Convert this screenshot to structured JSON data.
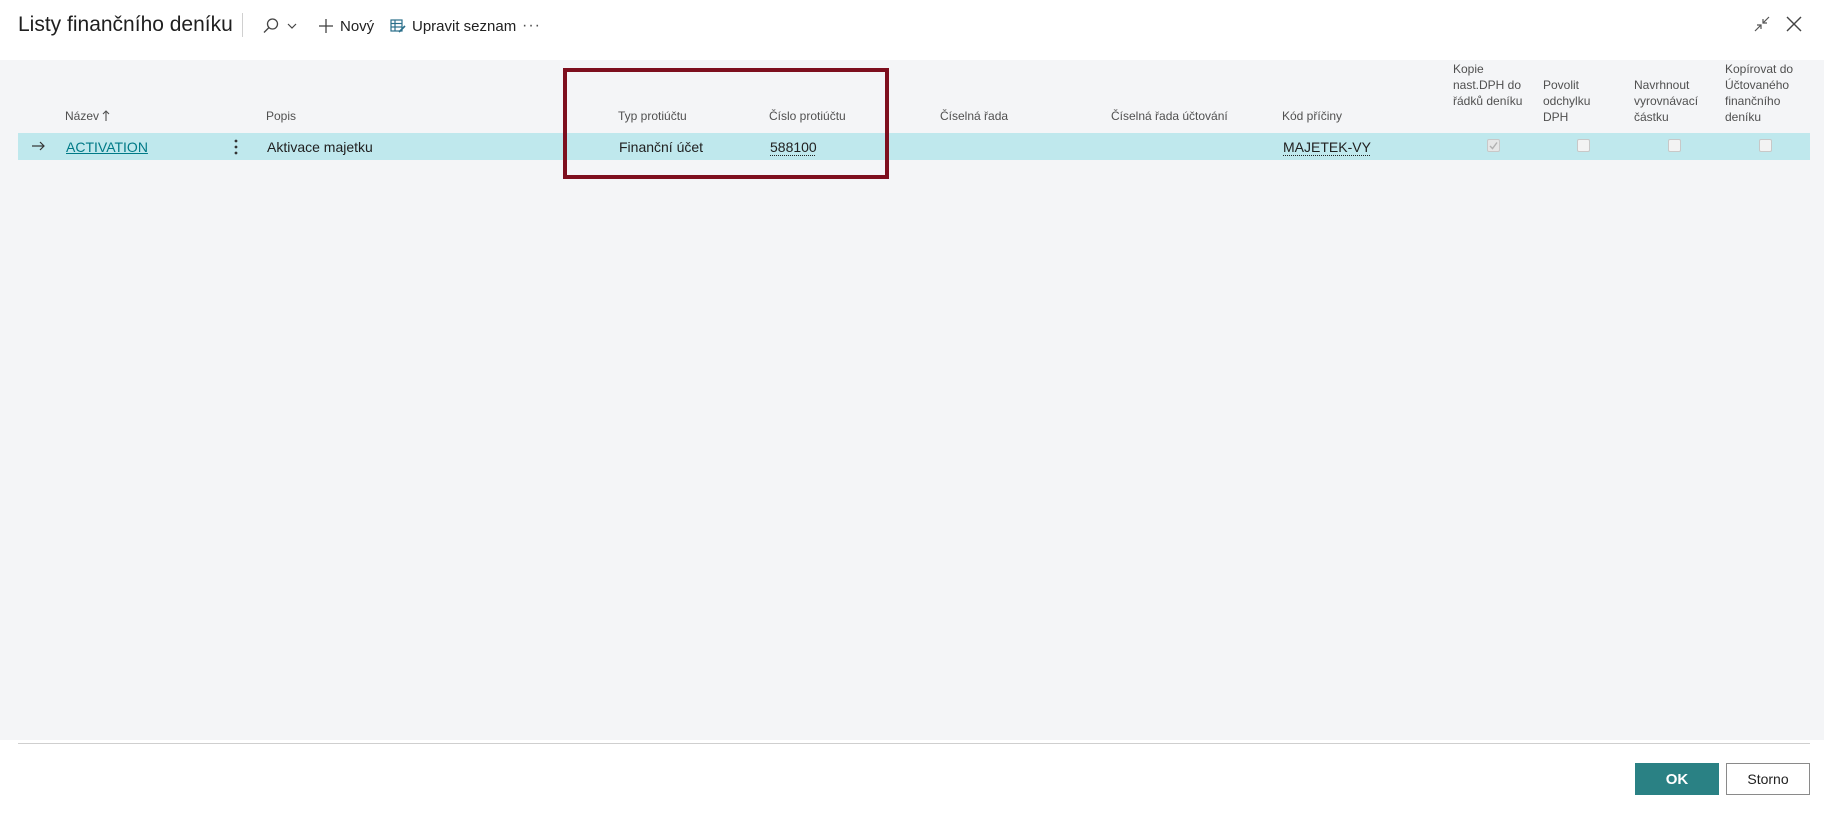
{
  "header": {
    "title": "Listy finančního deníku",
    "new_label": "Nový",
    "edit_list_label": "Upravit seznam",
    "more_label": "···"
  },
  "columns": {
    "name": "Název",
    "description": "Popis",
    "bal_account_type": "Typ protiúčtu",
    "bal_account_no": "Číslo protiúčtu",
    "no_series": "Číselná řada",
    "posting_no_series": "Číselná řada účtování",
    "reason_code": "Kód příčiny",
    "copy_vat_setup": "Kopie nast.DPH do řádků deníku",
    "allow_vat_difference": "Povolit odchylku DPH",
    "suggest_balancing": "Navrhnout vyrovnávací částku",
    "copy_to_posted": "Kopírovat do Účtovaného finančního deníku"
  },
  "rows": [
    {
      "name": "ACTIVATION",
      "description": "Aktivace majetku",
      "bal_account_type": "Finanční účet",
      "bal_account_no": "588100",
      "no_series": "",
      "posting_no_series": "",
      "reason_code": "MAJETEK-VY",
      "copy_vat_setup": true,
      "allow_vat_difference": false,
      "suggest_balancing": false,
      "copy_to_posted": false
    }
  ],
  "footer": {
    "ok_label": "OK",
    "cancel_label": "Storno"
  },
  "colors": {
    "accent": "#2a8184",
    "link": "#007a87",
    "selected_row": "#bfe8ed",
    "highlight_box": "#7d0f1e"
  },
  "icons": {
    "search": "search-icon",
    "new": "plus-icon",
    "edit_list": "edit-list-icon",
    "collapse": "collapse-icon",
    "close": "close-icon",
    "row_arrow": "arrow-right-icon",
    "row_menu": "vertical-ellipsis-icon",
    "sort": "sort-ascending-icon"
  }
}
